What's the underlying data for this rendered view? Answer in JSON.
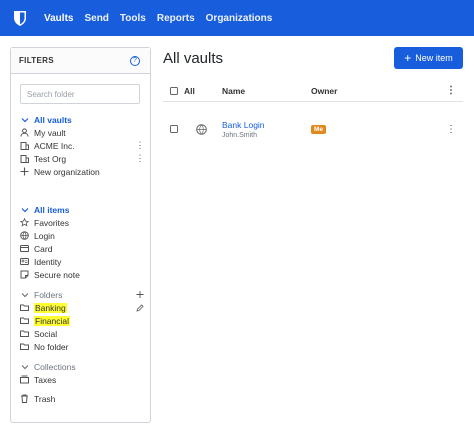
{
  "nav": {
    "logo_icon": "bitwarden-shield-icon",
    "links": [
      {
        "label": "Vaults",
        "active": true
      },
      {
        "label": "Send",
        "active": false
      },
      {
        "label": "Tools",
        "active": false
      },
      {
        "label": "Reports",
        "active": false
      },
      {
        "label": "Organizations",
        "active": false
      }
    ]
  },
  "sidebar": {
    "title": "FILTERS",
    "search_placeholder": "Search folder",
    "vaults_header": "All vaults",
    "vaults": [
      {
        "label": "My vault",
        "icon": "user-icon"
      },
      {
        "label": "ACME Inc.",
        "icon": "organization-icon"
      },
      {
        "label": "Test Org",
        "icon": "organization-icon"
      },
      {
        "label": "New organization",
        "icon": "plus-icon"
      }
    ],
    "items_header": "All items",
    "types": [
      {
        "label": "Favorites",
        "icon": "star-icon"
      },
      {
        "label": "Login",
        "icon": "globe-icon"
      },
      {
        "label": "Card",
        "icon": "credit-card-icon"
      },
      {
        "label": "Identity",
        "icon": "id-card-icon"
      },
      {
        "label": "Secure note",
        "icon": "sticky-note-icon"
      }
    ],
    "folders_header": "Folders",
    "folders": [
      {
        "label": "Banking",
        "highlight": true
      },
      {
        "label": "Financial",
        "highlight": true
      },
      {
        "label": "Social",
        "highlight": false
      },
      {
        "label": "No folder",
        "highlight": false
      }
    ],
    "collections_header": "Collections",
    "collections": [
      {
        "label": "Taxes"
      }
    ],
    "trash": "Trash"
  },
  "main": {
    "title": "All vaults",
    "new_item": "New item",
    "columns": {
      "all": "All",
      "name": "Name",
      "owner": "Owner"
    },
    "rows": [
      {
        "name": "Bank Login",
        "username": "John.Smith",
        "owner": "Me",
        "icon": "globe-icon"
      }
    ]
  },
  "colors": {
    "brand": "#175ddc",
    "highlight": "#ffff33",
    "owner_badge": "#e08a1e"
  }
}
